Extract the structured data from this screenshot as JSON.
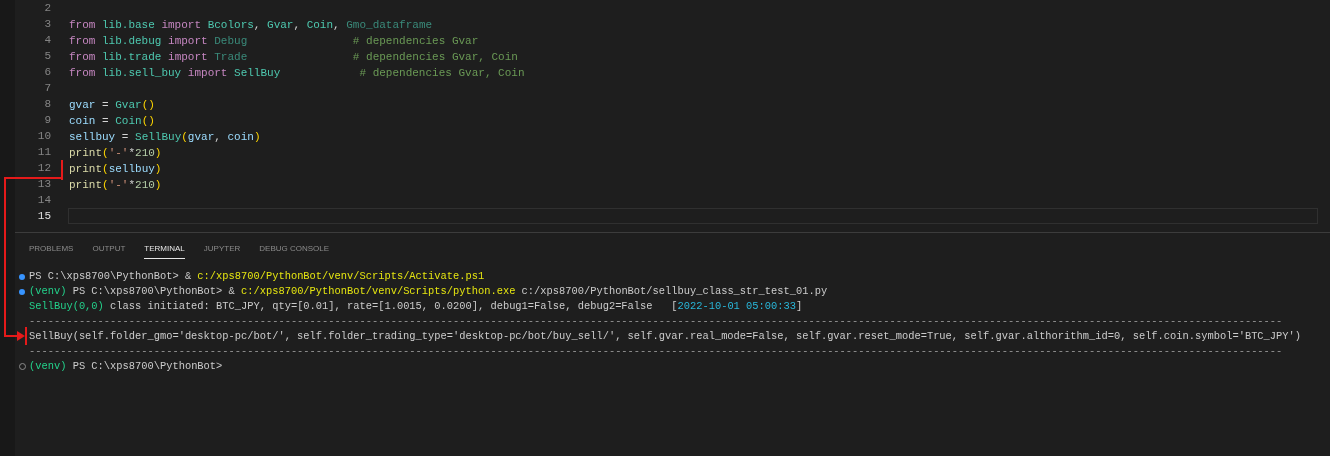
{
  "editor": {
    "lines": [
      {
        "number": "2",
        "current": false
      },
      {
        "number": "3",
        "current": false,
        "tokens": [
          {
            "kind": "keyword",
            "text": "from"
          },
          {
            "kind": "module",
            "text": " lib.base "
          },
          {
            "kind": "keyword",
            "text": "import"
          },
          {
            "kind": "class",
            "text": " Bcolors"
          },
          {
            "kind": "plain",
            "text": ", "
          },
          {
            "kind": "class",
            "text": "Gvar"
          },
          {
            "kind": "plain",
            "text": ", "
          },
          {
            "kind": "class",
            "text": "Coin"
          },
          {
            "kind": "plain",
            "text": ", "
          },
          {
            "kind": "class_unused",
            "text": "Gmo_dataframe"
          }
        ]
      },
      {
        "number": "4",
        "current": false,
        "tokens": [
          {
            "kind": "keyword",
            "text": "from"
          },
          {
            "kind": "module",
            "text": " lib.debug "
          },
          {
            "kind": "keyword",
            "text": "import"
          },
          {
            "kind": "class_unused",
            "text": " Debug"
          },
          {
            "kind": "comment",
            "text": "                # dependencies Gvar"
          }
        ]
      },
      {
        "number": "5",
        "current": false,
        "tokens": [
          {
            "kind": "keyword",
            "text": "from"
          },
          {
            "kind": "module",
            "text": " lib.trade "
          },
          {
            "kind": "keyword",
            "text": "import"
          },
          {
            "kind": "class_unused",
            "text": " Trade"
          },
          {
            "kind": "comment",
            "text": "                # dependencies Gvar, Coin"
          }
        ]
      },
      {
        "number": "6",
        "current": false,
        "tokens": [
          {
            "kind": "keyword",
            "text": "from"
          },
          {
            "kind": "module",
            "text": " lib.sell_buy "
          },
          {
            "kind": "keyword",
            "text": "import"
          },
          {
            "kind": "class",
            "text": " SellBuy"
          },
          {
            "kind": "comment",
            "text": "            # dependencies Gvar, Coin"
          }
        ]
      },
      {
        "number": "7",
        "current": false
      },
      {
        "number": "8",
        "current": false,
        "tokens": [
          {
            "kind": "variable",
            "text": "gvar"
          },
          {
            "kind": "plain",
            "text": " = "
          },
          {
            "kind": "class",
            "text": "Gvar"
          },
          {
            "kind": "bracket",
            "text": "()"
          }
        ]
      },
      {
        "number": "9",
        "current": false,
        "tokens": [
          {
            "kind": "variable",
            "text": "coin"
          },
          {
            "kind": "plain",
            "text": " = "
          },
          {
            "kind": "class",
            "text": "Coin"
          },
          {
            "kind": "bracket",
            "text": "()"
          }
        ]
      },
      {
        "number": "10",
        "current": false,
        "tokens": [
          {
            "kind": "variable",
            "text": "sellbuy"
          },
          {
            "kind": "plain",
            "text": " = "
          },
          {
            "kind": "class",
            "text": "SellBuy"
          },
          {
            "kind": "bracket",
            "text": "("
          },
          {
            "kind": "variable",
            "text": "gvar"
          },
          {
            "kind": "plain",
            "text": ", "
          },
          {
            "kind": "variable",
            "text": "coin"
          },
          {
            "kind": "bracket",
            "text": ")"
          }
        ]
      },
      {
        "number": "11",
        "current": false,
        "tokens": [
          {
            "kind": "function",
            "text": "print"
          },
          {
            "kind": "bracket",
            "text": "("
          },
          {
            "kind": "string",
            "text": "'-'"
          },
          {
            "kind": "plain",
            "text": "*"
          },
          {
            "kind": "number",
            "text": "210"
          },
          {
            "kind": "bracket",
            "text": ")"
          }
        ]
      },
      {
        "number": "12",
        "current": false,
        "tokens": [
          {
            "kind": "function",
            "text": "print"
          },
          {
            "kind": "bracket",
            "text": "("
          },
          {
            "kind": "variable",
            "text": "sellbuy"
          },
          {
            "kind": "bracket",
            "text": ")"
          }
        ]
      },
      {
        "number": "13",
        "current": false,
        "tokens": [
          {
            "kind": "function",
            "text": "print"
          },
          {
            "kind": "bracket",
            "text": "("
          },
          {
            "kind": "string",
            "text": "'-'"
          },
          {
            "kind": "plain",
            "text": "*"
          },
          {
            "kind": "number",
            "text": "210"
          },
          {
            "kind": "bracket",
            "text": ")"
          }
        ]
      },
      {
        "number": "14",
        "current": false
      },
      {
        "number": "15",
        "current": true
      }
    ]
  },
  "panel": {
    "tabs": [
      {
        "label": "PROBLEMS",
        "selected": false
      },
      {
        "label": "OUTPUT",
        "selected": false
      },
      {
        "label": "TERMINAL",
        "selected": true
      },
      {
        "label": "JUPYTER",
        "selected": false
      },
      {
        "label": "DEBUG CONSOLE",
        "selected": false
      }
    ],
    "terminal_lines": [
      {
        "kind": "success",
        "segments": [
          {
            "kind": "plain",
            "text": "PS C:\\xps8700\\PythonBot> & "
          },
          {
            "kind": "path",
            "text": "c:/xps8700/PythonBot/venv/Scripts/Activate.ps1"
          }
        ]
      },
      {
        "kind": "success",
        "segments": [
          {
            "kind": "venv",
            "text": "(venv)"
          },
          {
            "kind": "plain",
            "text": " PS C:\\xps8700\\PythonBot> & "
          },
          {
            "kind": "path",
            "text": "c:/xps8700/PythonBot/venv/Scripts/python.exe"
          },
          {
            "kind": "plain",
            "text": " c:/xps8700/PythonBot/sellbuy_class_str_test_01.py"
          }
        ]
      },
      {
        "kind": "output",
        "segments": [
          {
            "kind": "venv",
            "text": "SellBuy(0,0)"
          },
          {
            "kind": "plain",
            "text": " class initiated: BTC_JPY, qty=[0.01], rate=[1.0015, 0.0200], debug1=False, debug2=False   ["
          },
          {
            "kind": "time",
            "text": "2022-10-01 05:00:33"
          },
          {
            "kind": "plain",
            "text": "]"
          }
        ]
      },
      {
        "kind": "output",
        "segments": [
          {
            "kind": "rule",
            "text": "---------------------------------------------------------------------------------------------------------------------------------------------------------------------------------------------------------"
          }
        ]
      },
      {
        "kind": "output",
        "segments": [
          {
            "kind": "plain",
            "text": "SellBuy(self.folder_gmo='desktop-pc/bot/', self.folder_trading_type='desktop-pc/bot/buy_sell/', self.gvar.real_mode=False, self.gvar.reset_mode=True, self.gvar.althorithm_id=0, self.coin.symbol='BTC_JPY')"
          }
        ]
      },
      {
        "kind": "output",
        "segments": [
          {
            "kind": "rule",
            "text": "---------------------------------------------------------------------------------------------------------------------------------------------------------------------------------------------------------"
          }
        ]
      },
      {
        "kind": "idle",
        "segments": [
          {
            "kind": "venv",
            "text": "(venv)"
          },
          {
            "kind": "plain",
            "text": " PS C:\\xps8700\\PythonBot>"
          }
        ]
      }
    ]
  }
}
